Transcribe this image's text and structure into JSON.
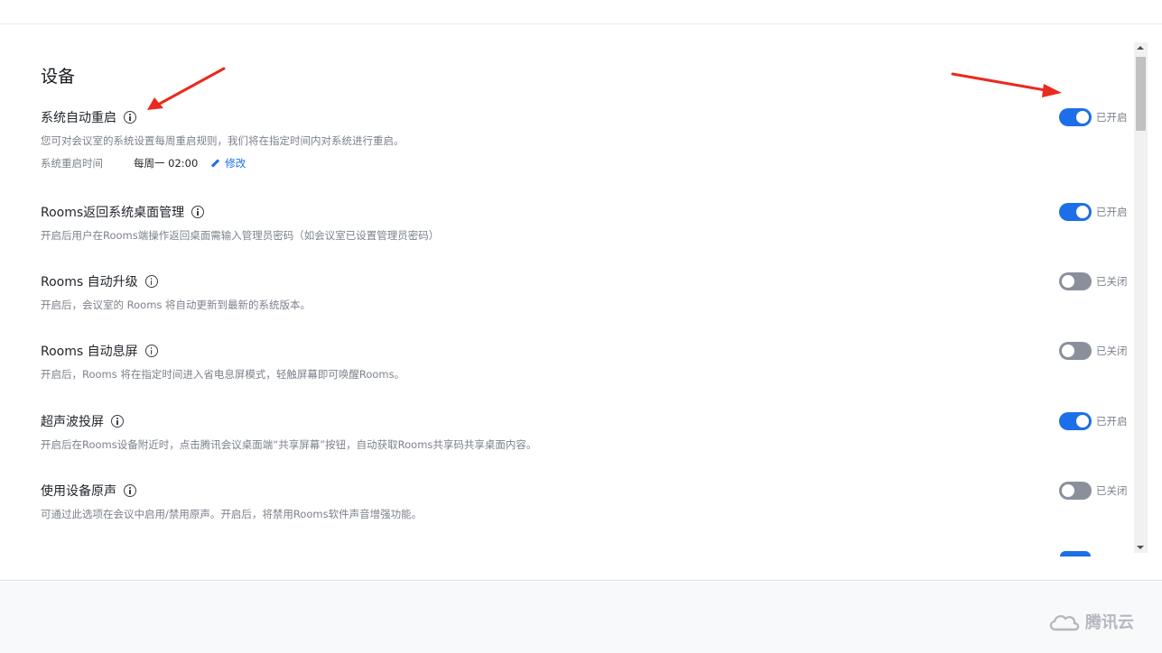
{
  "section": {
    "title": "设备"
  },
  "settings": [
    {
      "title": "系统自动重启",
      "desc": "您可对会议室的系统设置每周重启规则，我们将在指定时间内对系统进行重启。",
      "state": "on",
      "status": "已开启",
      "schedule": {
        "label": "系统重启时间",
        "value": "每周一 02:00",
        "edit": "修改"
      }
    },
    {
      "title": "Rooms返回系统桌面管理",
      "desc": "开启后用户在Rooms端操作返回桌面需输入管理员密码（如会议室已设置管理员密码）",
      "state": "on",
      "status": "已开启"
    },
    {
      "title": "Rooms 自动升级",
      "desc": "开启后，会议室的 Rooms 将自动更新到最新的系统版本。",
      "state": "off",
      "status": "已关闭"
    },
    {
      "title": "Rooms 自动息屏",
      "desc": "开启后，Rooms 将在指定时间进入省电息屏模式，轻触屏幕即可唤醒Rooms。",
      "state": "off",
      "status": "已关闭"
    },
    {
      "title": "超声波投屏",
      "desc": "开启后在Rooms设备附近时，点击腾讯会议桌面端“共享屏幕”按钮，自动获取Rooms共享码共享桌面内容。",
      "state": "on",
      "status": "已开启"
    },
    {
      "title": "使用设备原声",
      "desc": "可通过此选项在会议中启用/禁用原声。开启后，将禁用Rooms软件声音增强功能。",
      "state": "off",
      "status": "已关闭"
    }
  ],
  "watermark": {
    "text": "腾讯云",
    "icon": "cloud-icon"
  },
  "colors": {
    "accent": "#1c6fe8",
    "toggle_off": "#8a909b",
    "annotation_arrow": "#ea2a1f"
  }
}
